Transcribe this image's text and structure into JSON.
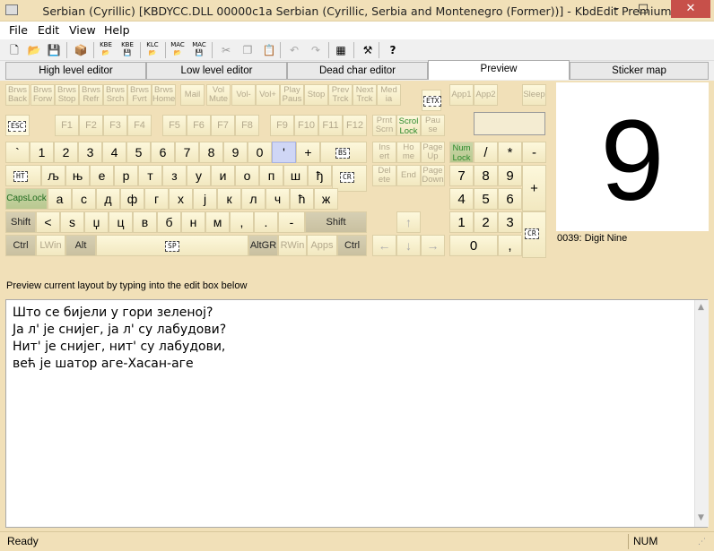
{
  "window": {
    "title": "Serbian (Cyrillic) [KBDYCC.DLL 00000c1a Serbian (Cyrillic, Serbia and Montenegro (Former))] - KbdEdit Premium",
    "minimize": "–",
    "maximize": "□",
    "close": "✕"
  },
  "menu": {
    "file": "File",
    "edit": "Edit",
    "view": "View",
    "help": "Help"
  },
  "toolbar": {
    "icons": [
      "new-file-icon",
      "open-folder-icon",
      "save-disk-icon",
      "package-icon",
      "kbe-open-icon",
      "kbe-save-icon",
      "klc-open-icon",
      "mac-open-icon",
      "mac-save-icon",
      "cut-icon",
      "copy-icon",
      "paste-icon",
      "undo-icon",
      "redo-icon",
      "character-map-icon",
      "tools-icon",
      "help-icon"
    ],
    "labels": {
      "kbe": "KBE",
      "klc": "KLC",
      "mac": "MAC"
    }
  },
  "tabs": [
    "High level editor",
    "Low level editor",
    "Dead char editor",
    "Preview",
    "Sticker map"
  ],
  "active_tab": "Preview",
  "keyboard": {
    "media_row": [
      "Brws Back",
      "Brws Forw",
      "Brws Stop",
      "Brws Refr",
      "Brws Srch",
      "Brws Fvrt",
      "Brws Home",
      "Mail",
      "Vol Mute",
      "Vol-",
      "Vol+",
      "Play Paus",
      "Stop",
      "Prev Trck",
      "Next Trck",
      "Med ia"
    ],
    "etx": "ETX",
    "app_keys": [
      "App1",
      "App2"
    ],
    "sleep": "Sleep",
    "esc": "ESC",
    "f_keys": [
      "F1",
      "F2",
      "F3",
      "F4",
      "F5",
      "F6",
      "F7",
      "F8",
      "F9",
      "F10",
      "F11",
      "F12"
    ],
    "nav_top": [
      "Prnt Scrn",
      "Scrol Lock",
      "Pau se"
    ],
    "nav_mid": [
      "Ins ert",
      "Ho me",
      "Page Up"
    ],
    "nav_bot": [
      "Del ete",
      "End",
      "Page Down"
    ],
    "row_num": [
      "`",
      "1",
      "2",
      "3",
      "4",
      "5",
      "6",
      "7",
      "8",
      "9",
      "0",
      "'",
      "+"
    ],
    "bs": "BS",
    "ht": "HT",
    "row_q": [
      "љ",
      "њ",
      "е",
      "р",
      "т",
      "з",
      "у",
      "и",
      "о",
      "п",
      "ш",
      "ђ"
    ],
    "cr": "CR",
    "capslock": "CapsLock",
    "row_a": [
      "а",
      "с",
      "д",
      "ф",
      "г",
      "х",
      "ј",
      "к",
      "л",
      "ч",
      "ћ",
      "ж"
    ],
    "shift": "Shift",
    "row_z": [
      "<",
      "ѕ",
      "џ",
      "ц",
      "в",
      "б",
      "н",
      "м",
      ",",
      ".",
      "-"
    ],
    "bottom": {
      "ctrl": "Ctrl",
      "lwin": "LWin",
      "alt": "Alt",
      "sp": "SP",
      "altgr": "AltGR",
      "rwin": "RWin",
      "apps": "Apps"
    },
    "arrows": [
      "↑",
      "←",
      "↓",
      "→"
    ],
    "numpad": {
      "numlock": "Num Lock",
      "row1": [
        "/",
        "*",
        "-"
      ],
      "row2": [
        "7",
        "8",
        "9"
      ],
      "row3": [
        "4",
        "5",
        "6"
      ],
      "row4": [
        "1",
        "2",
        "3"
      ],
      "zero": "0",
      "dot": ",",
      "plus": "+",
      "enter": "CR"
    }
  },
  "preview": {
    "char": "9",
    "label": "0039: Digit Nine"
  },
  "instruction": "Preview current layout by typing into the edit box below",
  "editbox": {
    "lines": [
      "Што се бијели у гори зеленој?",
      "Ја л' је снијег, ја л' су лабудови?",
      "Нит' је снијег, нит' су лабудови,",
      "већ је шатор аге-Хасан-аге"
    ]
  },
  "status": {
    "left": "Ready",
    "num": "NUM"
  }
}
